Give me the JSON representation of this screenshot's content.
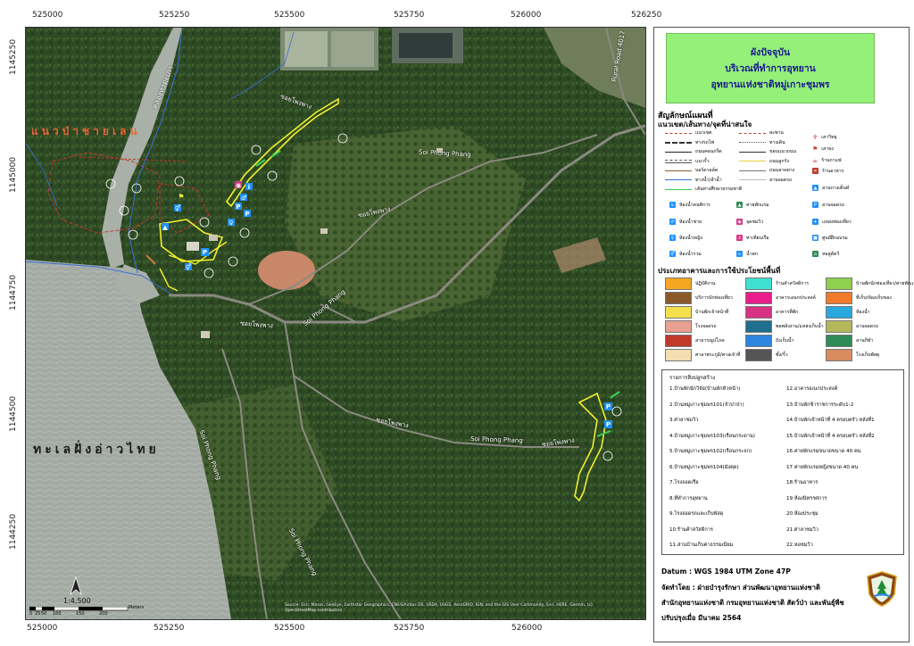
{
  "colors": {
    "title_bg": "#95f07a",
    "title_text": "#1a1a8c",
    "road_yellow": "#f2ef2e",
    "forest": "#2f4a25",
    "sea": "#9fa6a0"
  },
  "axes": {
    "x_ticks": [
      "525000",
      "525250",
      "525500",
      "525750",
      "526000",
      "526250"
    ],
    "y_ticks": [
      "1145250",
      "1145000",
      "1144750",
      "1144500",
      "1144250"
    ]
  },
  "map": {
    "labels": {
      "mangrove": "แนวป่าชายเลน",
      "sea": "ทะเลฝั่งอ่าวไทย",
      "canal": "คลองท่าตะเภา",
      "road_4017": "Rural Road 4017",
      "soi_1": "ซอยโพงพาง",
      "soi_2": "Soi Phong Phang",
      "soi_3": "Soi Phong Phang",
      "soi_4": "Soi Phong Phang",
      "soi_5": "ซอยโพงพาง",
      "soi_6": "ซอยโพงพาง",
      "soi_7": "Soi Phong Phang",
      "soi_8": "ซอยโพงพาง",
      "soi_9": "ซอยโพงพาง",
      "soi_10": "Soi Phong Phang"
    },
    "scale": {
      "ratio": "1:4,500",
      "unit": "Meters",
      "ticks": [
        "0",
        "25",
        "50",
        "100",
        "150",
        "200"
      ]
    },
    "credit_1": "Source: Esri, Maxar, GeoEye, Earthstar Geographics, CNES/Airbus DS, USDA, USGS, AeroGRID, IGN, and the GIS User Community, Esri, HERE, Garmin, (c)",
    "credit_2": "OpenStreetMap contributors"
  },
  "legend": {
    "title_1": "ผังปัจจุบัน",
    "title_2": "บริเวณที่ทำการอุทยาน",
    "title_3": "อุทยานแห่งชาติหมู่เกาะชุมพร",
    "symbols_title": "สัญลักษณ์แผนที่",
    "routes_title": "แนวเขต/เส้นทาง/จุดที่น่าสนใจ",
    "line_items": [
      {
        "label": "แนวเขต",
        "color": "#c0392b",
        "style": "dashed"
      },
      {
        "label": "ทางรถไฟ",
        "color": "#333333",
        "style": "rail"
      },
      {
        "label": "ถนนคอนกรีต",
        "color": "#222222",
        "style": "solid"
      },
      {
        "label": "แนวรั้ว",
        "color": "#555555",
        "style": "fence"
      },
      {
        "label": "บอร์ดวอล์ค",
        "color": "#8b5a2b",
        "style": "solid"
      },
      {
        "label": "ทางน้ำ/ลำน้ำ",
        "color": "#3a6fd8",
        "style": "solid"
      },
      {
        "label": "เส้นทางศึกษาธรรมชาติ",
        "color": "#39d353",
        "style": "solid"
      }
    ],
    "line_items_2": [
      {
        "label": "สะพาน",
        "color": "#c0392b",
        "style": "dashed"
      },
      {
        "label": "ทางเดิน",
        "color": "#555555",
        "style": "dotted"
      },
      {
        "label": "ขอบแนวถนน",
        "color": "#333333",
        "style": "solid"
      },
      {
        "label": "ถนนลูกรัง",
        "color": "#e6d13a",
        "style": "solid"
      },
      {
        "label": "ถนนลาดยาง",
        "color": "#777777",
        "style": "solid"
      },
      {
        "label": "ลานจอดรถ",
        "color": "#bbbbbb",
        "style": "solid"
      }
    ],
    "point_items_1": [
      {
        "label": "เสาวิทยุ",
        "color": "#e74c3c",
        "glyph": "♆"
      },
      {
        "label": "เสาธง",
        "color": "#c0392b",
        "glyph": "⚑"
      },
      {
        "label": "ร้านกาแฟ",
        "color": "#c0392b",
        "glyph": "☕"
      }
    ],
    "facility_items": [
      {
        "label": "ห้องน้ำคนพิการ",
        "color": "#1e90ff",
        "glyph": "♿"
      },
      {
        "label": "ห้องน้ำชาย",
        "color": "#1e90ff",
        "glyph": "♂"
      },
      {
        "label": "ห้องน้ำหญิง",
        "color": "#1e90ff",
        "glyph": "♀"
      },
      {
        "label": "ห้องน้ำรวม",
        "color": "#1e90ff",
        "glyph": "⚥"
      },
      {
        "label": "ค่ายพักแรม",
        "color": "#2e8b57",
        "glyph": "▲"
      },
      {
        "label": "จุดชมวิว",
        "color": "#d63384",
        "glyph": "◉"
      },
      {
        "label": "ท่าเทียบเรือ",
        "color": "#d63384",
        "glyph": "⚓"
      },
      {
        "label": "น้ำตก",
        "color": "#1e90ff",
        "glyph": "≈"
      },
      {
        "label": "ร้านอาหาร",
        "color": "#c0392b",
        "glyph": "✕"
      },
      {
        "label": "ลานกางเต็นท์",
        "color": "#1e90ff",
        "glyph": "▲"
      },
      {
        "label": "ลานจอดรถ",
        "color": "#1e90ff",
        "glyph": "P"
      },
      {
        "label": "แหล่งท่องเที่ยว",
        "color": "#1e90ff",
        "glyph": "✦"
      },
      {
        "label": "ศูนย์ฝึกอบรม",
        "color": "#1e90ff",
        "glyph": "■"
      },
      {
        "label": "หอสูดัดวิ",
        "color": "#2e8b57",
        "glyph": "⌂"
      }
    ],
    "building_title": "ประเภทอาคารและการใช้ประโยชน์พื้นที่",
    "building_types": [
      {
        "label": "ปฏิบัติงาน",
        "color": "#f5a623"
      },
      {
        "label": "บริการนักท่องเที่ยว",
        "color": "#8b5a2b"
      },
      {
        "label": "บ้านพักเจ้าหน้าที่",
        "color": "#f4e04d"
      },
      {
        "label": "โรงจอดรถ",
        "color": "#e8a090"
      },
      {
        "label": "สาธารณูปโภค",
        "color": "#c0392b"
      },
      {
        "label": "ศาลาพระภูมิ/ศาลเจ้าที่",
        "color": "#f5deb3"
      },
      {
        "label": "ร้านค้าสวัสดิการ",
        "color": "#40e0d0"
      },
      {
        "label": "อาคารเอนกประสงค์",
        "color": "#e91e8c"
      },
      {
        "label": "อาคารที่พัก",
        "color": "#d63384"
      },
      {
        "label": "พลพลังงาน/แหล่งเก็บน้ำ",
        "color": "#1e6f8c"
      },
      {
        "label": "ถังเก็บน้ำ",
        "color": "#2e86de"
      },
      {
        "label": "ซั้ง/รั้ว",
        "color": "#555555"
      },
      {
        "label": "บ้านพักนักท่องเที่ยว/ค่ายพักแรม",
        "color": "#8fd14f"
      },
      {
        "label": "ที่เก็บ/ห้องเก็บของ",
        "color": "#f27b2b"
      },
      {
        "label": "ห้องน้ำ",
        "color": "#29a8e0"
      },
      {
        "label": "ลานจอดรถ",
        "color": "#b5b85a"
      },
      {
        "label": "ลานกีฬา",
        "color": "#2e8b57"
      },
      {
        "label": "โรงเก็บพัสดุ",
        "color": "#d98c5f"
      }
    ],
    "building_list_title": "รายการสิ่งปลูกสร้าง",
    "building_list_left": [
      "1.บ้านพักนักวิจัย(บ้านพักหัวหน้า)",
      "2.บ้านหมู่เกาะชุมพร101(จำปาป่า)",
      "3.ศาลาชมวิว",
      "4.บ้านหมู่เกาะชุมพร103(เรือนกระดาน)",
      "5.บ้านหมู่เกาะชุมพร102(เรือนกระจก)",
      "6.บ้านหมู่เกาะชุมพร104(มังคุด)",
      "7.โรงจอดเรือ",
      "8.ที่ทำการอุทยาน",
      "9.โรงจอดรถและเก็บพัสดุ",
      "10.ร้านค้าสวัสดิการ",
      "11.ส่านบ้านเก็บค่าธรรมเนียม"
    ],
    "building_list_right": [
      "12.อาคารอเนกประสงค์",
      "13.บ้านพักข้าราชการระดับ1-2",
      "14.บ้านพักเจ้าหน้าที่ 4 ครอบครัว หลังที่1",
      "15.บ้านพักเจ้าหน้าที่ 4 ครอบครัว หลังที่2",
      "16.ค่ายพักแรมขนาดขนาด 40 คน",
      "17.ค่ายพักแรมหญิงขนาด 40 คน",
      "18.ร้านอาหาร",
      "19.ห้องนิทรรศการ",
      "20.ห้องประชุม",
      "21.ศาลาชมวิว",
      "22.หอชมวิว"
    ],
    "datum": "Datum  :  WGS 1984 UTM Zone 47P",
    "made_by": "จัดทำโดย  :  ฝ่ายบำรุงรักษา ส่วนพัฒนาอุทยานแห่งชาติ",
    "dept": "สำนักอุทยานแห่งชาติ  กรมอุทยานแห่งชาติ สัตว์ป่า และพันธุ์พืช",
    "updated": "ปรับปรุงเมื่อ มีนาคม 2564"
  }
}
